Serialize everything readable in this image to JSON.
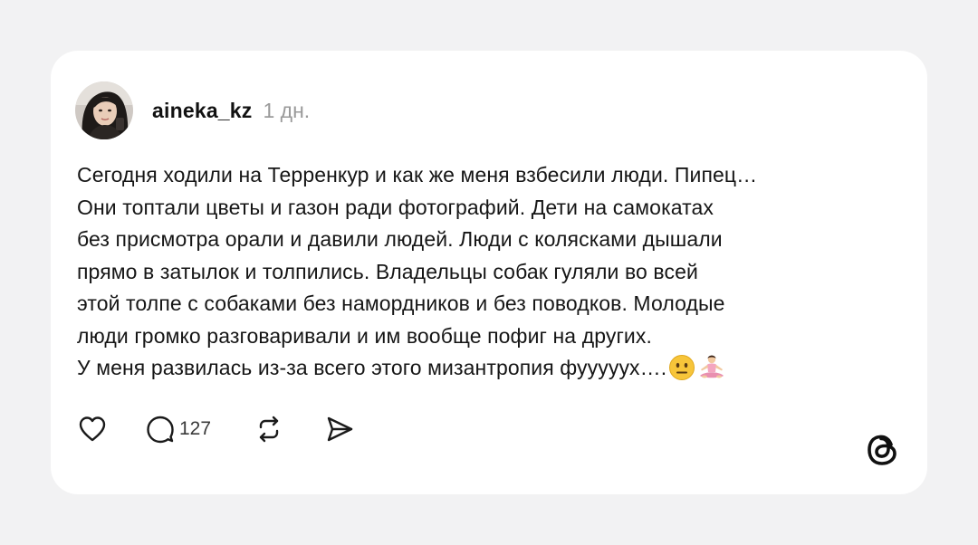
{
  "post": {
    "username": "aineka_kz",
    "time": "1 дн.",
    "text_lines": [
      "Сегодня ходили на Терренкур и как же меня взбесили люди. Пипец…",
      "Они топтали цветы и газон ради фотографий. Дети на самокатах",
      "без присмотра орали и давили людей. Люди с колясками дышали",
      "прямо в затылок и толпились. Владельцы собак гуляли во всей",
      "этой толпе с собаками без намордников и без поводков. Молодые",
      "люди громко разговаривали и им вообще пофиг на других.",
      "У меня развилась из-за всего этого мизантропия фуууууx…."
    ],
    "emojis": [
      "neutral-face-emoji",
      "person-in-lotus-position-emoji"
    ]
  },
  "actions": {
    "like_icon": "heart-icon",
    "reply_icon": "comment-bubble-icon",
    "reply_count": "127",
    "repost_icon": "repost-icon",
    "share_icon": "send-icon"
  },
  "branding": {
    "logo": "threads-logo-icon"
  },
  "colors": {
    "background": "#f2f2f3",
    "card": "#ffffff",
    "text": "#161616",
    "muted": "#9a9a9a"
  }
}
